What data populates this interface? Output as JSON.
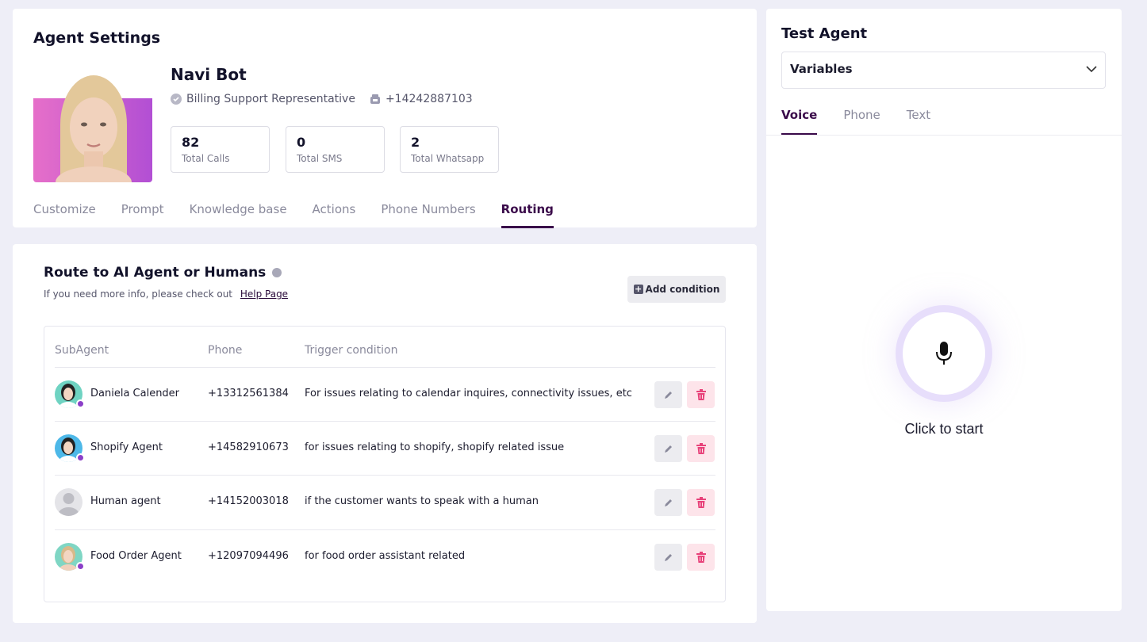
{
  "settings": {
    "title": "Agent Settings",
    "agent": {
      "name": "Navi Bot",
      "role": "Billing Support Representative",
      "phone": "+14242887103"
    },
    "stats": [
      {
        "value": "82",
        "label": "Total Calls"
      },
      {
        "value": "0",
        "label": "Total SMS"
      },
      {
        "value": "2",
        "label": "Total Whatsapp"
      }
    ],
    "tabs": [
      "Customize",
      "Prompt",
      "Knowledge base",
      "Actions",
      "Phone Numbers",
      "Routing"
    ],
    "active_tab": "Routing"
  },
  "routing": {
    "title": "Route to AI Agent or Humans",
    "subtitle": "If you need more info, please check out",
    "help_link": "Help Page",
    "add_button": "Add condition",
    "columns": [
      "SubAgent",
      "Phone",
      "Trigger condition"
    ],
    "rows": [
      {
        "name": "Daniela Calender",
        "phone": "+13312561384",
        "trigger": "For issues relating to calendar inquires, connectivity issues, etc"
      },
      {
        "name": "Shopify Agent",
        "phone": "+14582910673",
        "trigger": "for issues relating to shopify, shopify related issue"
      },
      {
        "name": "Human agent",
        "phone": "+14152003018",
        "trigger": "if the customer wants to speak with a human"
      },
      {
        "name": "Food Order Agent",
        "phone": "+12097094496",
        "trigger": "for food order assistant related"
      }
    ]
  },
  "test_agent": {
    "title": "Test Agent",
    "select_value": "Variables",
    "tabs": [
      "Voice",
      "Phone",
      "Text"
    ],
    "active_tab": "Voice",
    "start_label": "Click to start"
  },
  "colors": {
    "accent": "#3a0a4a",
    "background": "#eeeef7",
    "delete": "#e8427a",
    "mic_ring": "#e7defb"
  }
}
